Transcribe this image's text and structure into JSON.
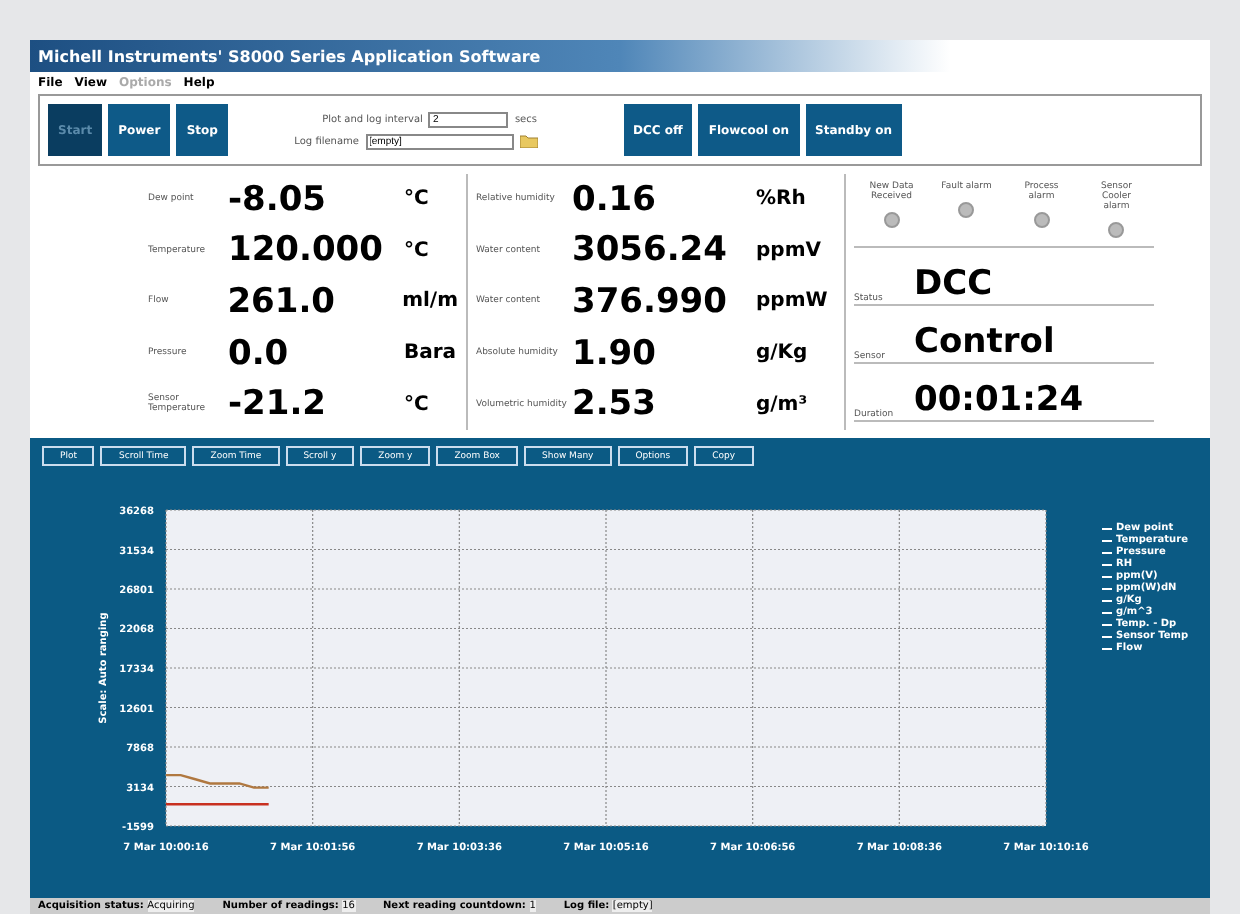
{
  "window": {
    "title": "Michell Instruments' S8000 Series Application Software"
  },
  "menu": [
    {
      "label": "File",
      "disabled": false
    },
    {
      "label": "View",
      "disabled": false
    },
    {
      "label": "Options",
      "disabled": true
    },
    {
      "label": "Help",
      "disabled": false
    }
  ],
  "controls": [
    {
      "label": "Start",
      "selected": true
    },
    {
      "label": "Power",
      "selected": false
    },
    {
      "label": "Stop",
      "selected": false
    }
  ],
  "interval": {
    "label": "Plot and log interval",
    "value": "2",
    "unit": "secs"
  },
  "log_file": {
    "label": "Log filename",
    "value": "[empty]"
  },
  "modes": [
    {
      "label": "DCC off"
    },
    {
      "label": "Flowcool on"
    },
    {
      "label": "Standby on"
    }
  ],
  "readings_left": [
    {
      "label": "Dew point",
      "value": "-8.05",
      "unit": "°C"
    },
    {
      "label": "Temperature",
      "value": "120.000",
      "unit": "°C"
    },
    {
      "label": "Flow",
      "value": "261.0",
      "unit": "ml/m"
    },
    {
      "label": "Pressure",
      "value": "0.0",
      "unit": "Bara"
    },
    {
      "label": "Sensor Temperature",
      "value": "-21.2",
      "unit": "°C"
    }
  ],
  "readings_mid": [
    {
      "label": "Relative humidity",
      "value": "0.16",
      "unit": "%Rh"
    },
    {
      "label": "Water content",
      "value": "3056.24",
      "unit": "ppmV"
    },
    {
      "label": "Water content",
      "value": "376.990",
      "unit": "ppmW"
    },
    {
      "label": "Absolute humidity",
      "value": "1.90",
      "unit": "g/Kg"
    },
    {
      "label": "Volumetric humidity",
      "value": "2.53",
      "unit": "g/m³"
    }
  ],
  "indicators": [
    {
      "label": "New Data Received",
      "on": false
    },
    {
      "label": "Fault alarm",
      "on": false
    },
    {
      "label": "Process alarm",
      "on": false
    },
    {
      "label": "Sensor Cooler alarm",
      "on": false
    }
  ],
  "status": [
    {
      "label": "Status",
      "value": "DCC"
    },
    {
      "label": "Sensor",
      "value": "Control"
    },
    {
      "label": "Duration",
      "value": "00:01:24"
    }
  ],
  "plot_toolbar": [
    "Plot",
    "Scroll Time",
    "Zoom Time",
    "Scroll y",
    "Zoom y",
    "Zoom Box",
    "Show Many",
    "Options",
    "Copy"
  ],
  "plot": {
    "chart_data": {
      "type": "line",
      "ylabel": "Scale: Auto ranging",
      "categories": [
        "7 Mar 10:00:16",
        null,
        null,
        null,
        null,
        null,
        null,
        null,
        null,
        null,
        "7 Mar 10:01:56",
        null,
        null,
        null,
        null,
        null,
        null,
        null,
        null,
        null,
        "7 Mar 10:03:36",
        null,
        null,
        null,
        null,
        null,
        null,
        null,
        null,
        null,
        "7 Mar 10:05:16",
        null,
        null,
        null,
        null,
        null,
        null,
        null,
        null,
        null,
        "7 Mar 10:06:56",
        null,
        null,
        null,
        null,
        null,
        null,
        null,
        null,
        null,
        "7 Mar 10:08:36",
        null,
        null,
        null,
        null,
        null,
        null,
        null,
        null,
        null,
        "7 Mar 10:10:16"
      ],
      "ylim": [
        -1599,
        36268
      ],
      "grid": true,
      "yticks": [
        -1599,
        3134,
        7868,
        12601,
        17334,
        22068,
        26801,
        31534,
        36268
      ],
      "series": [
        {
          "color": "#b07840",
          "values": [
            4500,
            4500,
            4000,
            3500,
            3500,
            3500,
            3000,
            3000,
            null,
            null,
            null,
            null,
            null,
            null,
            null,
            null,
            null,
            null,
            null,
            null,
            null,
            null,
            null,
            null,
            null,
            null,
            null,
            null,
            null,
            null,
            null,
            null,
            null,
            null,
            null,
            null,
            null,
            null,
            null,
            null,
            null,
            null,
            null,
            null,
            null,
            null,
            null,
            null,
            null,
            null,
            null,
            null,
            null,
            null,
            null,
            null,
            null,
            null,
            null,
            null,
            null
          ]
        },
        {
          "color": "#c83020",
          "values": [
            1000,
            1000,
            1000,
            1000,
            1000,
            1000,
            1000,
            1000,
            null,
            null,
            null,
            null,
            null,
            null,
            null,
            null,
            null,
            null,
            null,
            null,
            null,
            null,
            null,
            null,
            null,
            null,
            null,
            null,
            null,
            null,
            null,
            null,
            null,
            null,
            null,
            null,
            null,
            null,
            null,
            null,
            null,
            null,
            null,
            null,
            null,
            null,
            null,
            null,
            null,
            null,
            null,
            null,
            null,
            null,
            null,
            null,
            null,
            null,
            null,
            null,
            null
          ]
        }
      ]
    },
    "legend": [
      "Dew point",
      "Temperature",
      "Pressure",
      "RH",
      "ppm(V)",
      "ppm(W)dN",
      "g/Kg",
      "g/m^3",
      "Temp. - Dp",
      "Sensor Temp",
      "Flow"
    ]
  },
  "status_bar": [
    {
      "label": "Acquisition status:",
      "value": "Acquiring"
    },
    {
      "label": "Number of readings:",
      "value": "16"
    },
    {
      "label": "Next reading countdown:",
      "value": "1"
    },
    {
      "label": "Log file:",
      "value": "[empty]"
    }
  ]
}
